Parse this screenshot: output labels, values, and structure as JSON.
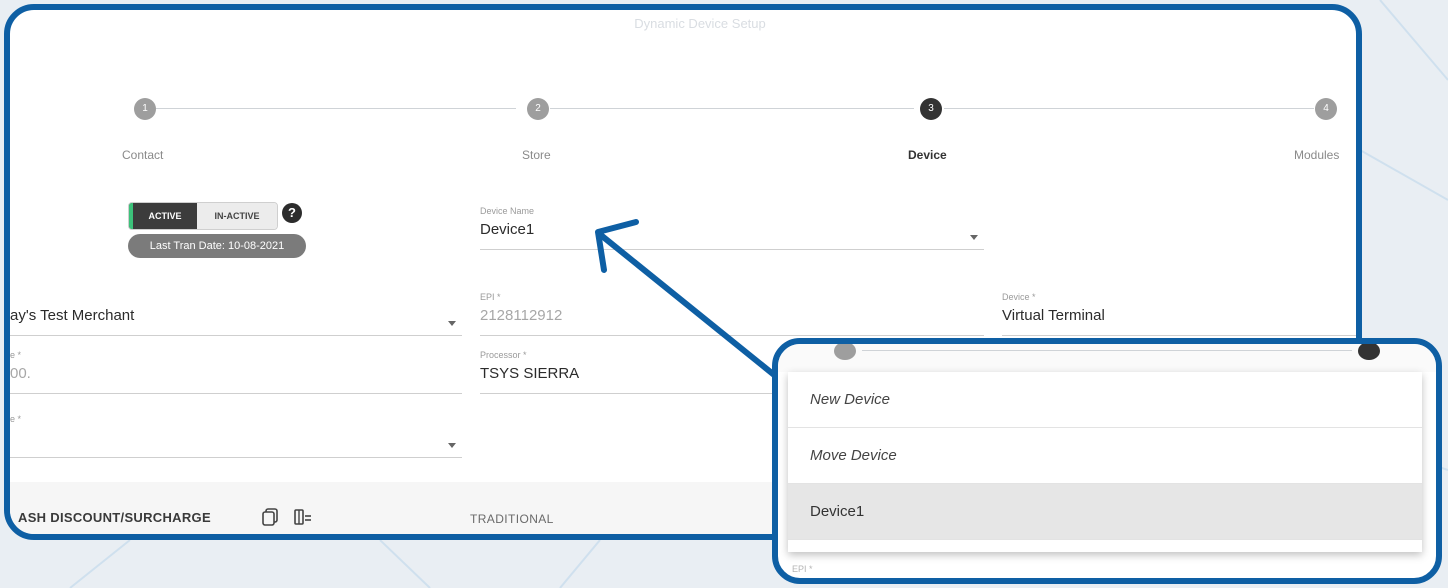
{
  "app": {
    "title": "Dynamic Device Setup"
  },
  "stepper": {
    "steps": [
      {
        "number": "1",
        "label": "Contact"
      },
      {
        "number": "2",
        "label": "Store"
      },
      {
        "number": "3",
        "label": "Device"
      },
      {
        "number": "4",
        "label": "Modules"
      }
    ],
    "active_step": "3"
  },
  "status": {
    "active_label": "ACTIVE",
    "inactive_label": "IN-ACTIVE",
    "help_icon": "question-circle-icon",
    "last_tran_label": "Last Tran Date: 10-08-2021"
  },
  "form": {
    "merchant": {
      "label": "",
      "value": "ay's Test Merchant"
    },
    "device_name": {
      "label": "Device Name",
      "value": "Device1"
    },
    "epi": {
      "label": "EPI *",
      "value": "2128112912"
    },
    "device": {
      "label": "Device *",
      "value": "Virtual Terminal"
    },
    "left_field2": {
      "label": "e *",
      "value": "00."
    },
    "processor": {
      "label": "Processor *",
      "value": "TSYS SIERRA"
    },
    "left_field3": {
      "label": "e *",
      "value": ""
    }
  },
  "bottom_bar": {
    "title": "ASH DISCOUNT/SURCHARGE",
    "copy_icon": "copy-icon",
    "columns_icon": "delete-columns-icon",
    "traditional_label": "TRADITIONAL"
  },
  "dropdown": {
    "options": [
      "New Device",
      "Move Device",
      "Device1"
    ],
    "selected": "Device1",
    "footer_label": "EPI *"
  },
  "colors": {
    "frame_blue": "#0e5fa4",
    "active_green": "#3cc27a",
    "dark_step": "#333333"
  }
}
